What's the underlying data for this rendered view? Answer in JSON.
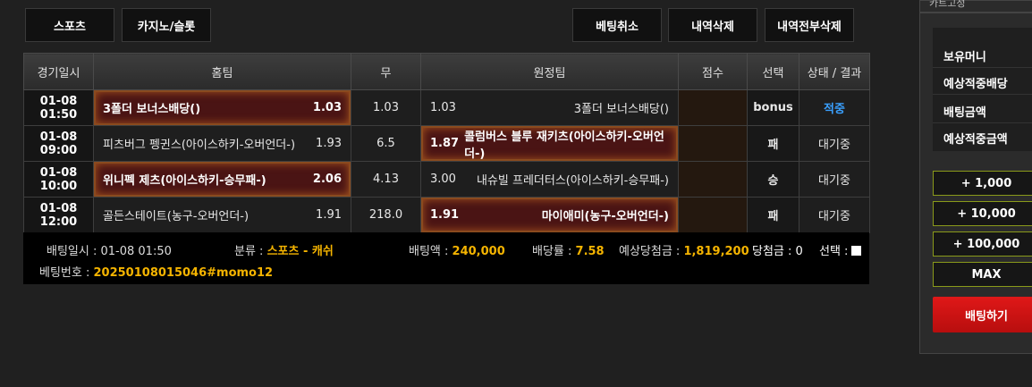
{
  "top_buttons": {
    "sports": "스포츠",
    "casino": "카지노/슬롯",
    "cancel_bet": "베팅취소",
    "delete_history": "내역삭제",
    "delete_all": "내역전부삭제"
  },
  "table": {
    "headers": [
      "경기일시",
      "홈팀",
      "무",
      "원정팀",
      "점수",
      "선택",
      "상태 / 결과"
    ],
    "rows": [
      {
        "date": "01-08 01:50",
        "home": "3폴더 보너스배당()",
        "home_odds": "1.03",
        "draw": "1.03",
        "away_odds": "1.03",
        "away": "3폴더 보너스배당()",
        "score": "",
        "pick": "bonus",
        "status": "적중",
        "selected": "home"
      },
      {
        "date": "01-08 09:00",
        "home": "피츠버그 펭귄스(아이스하키-오버언더-)",
        "home_odds": "1.93",
        "draw": "6.5",
        "away_odds": "1.87",
        "away": "콜럼버스 블루 재키츠(아이스하키-오버언더-)",
        "score": "",
        "pick": "패",
        "status": "대기중",
        "selected": "away"
      },
      {
        "date": "01-08 10:00",
        "home": "위니펙 제츠(아이스하키-승무패-)",
        "home_odds": "2.06",
        "draw": "4.13",
        "away_odds": "3.00",
        "away": "내슈빌 프레더터스(아이스하키-승무패-)",
        "score": "",
        "pick": "승",
        "status": "대기중",
        "selected": "home"
      },
      {
        "date": "01-08 12:00",
        "home": "골든스테이트(농구-오버언더-)",
        "home_odds": "1.91",
        "draw": "218.0",
        "away_odds": "1.91",
        "away": "마이애미(농구-오버언더-)",
        "score": "",
        "pick": "패",
        "status": "대기중",
        "selected": "away"
      }
    ]
  },
  "summary": {
    "bet_time_label": "배팅일시 : ",
    "bet_time": "01-08 01:50",
    "category_label": "분류 : ",
    "category_main": "스포츠",
    "category_dash": " - ",
    "category_sub": "캐쉬",
    "amount_label": "배팅액 : ",
    "amount": "240,000",
    "odds_label": "배당률 : ",
    "odds": "7.58",
    "expected_label": "예상당첨금 : ",
    "expected": "1,819,200",
    "win_label": "당첨금 : ",
    "win": "0",
    "select_label": "선택 :",
    "bet_no_label": "베팅번호 : ",
    "bet_no": "20250108015046#momo12"
  },
  "cart": {
    "title": "카트고정",
    "holding_money": "보유머니",
    "expected_accum_odds": "예상적중배당",
    "bet_amount": "배팅금액",
    "expected_accum_amount": "예상적중금액",
    "add_1000": "+ 1,000",
    "add_10000": "+ 10,000",
    "add_100000": "+ 100,000",
    "max": "MAX",
    "place_bet": "배팅하기"
  },
  "colors": {
    "accent_yellow": "#f5b400",
    "hit_blue": "#3aa0ff",
    "selected_bg": "#4a1414",
    "bet_red": "#d41414"
  }
}
